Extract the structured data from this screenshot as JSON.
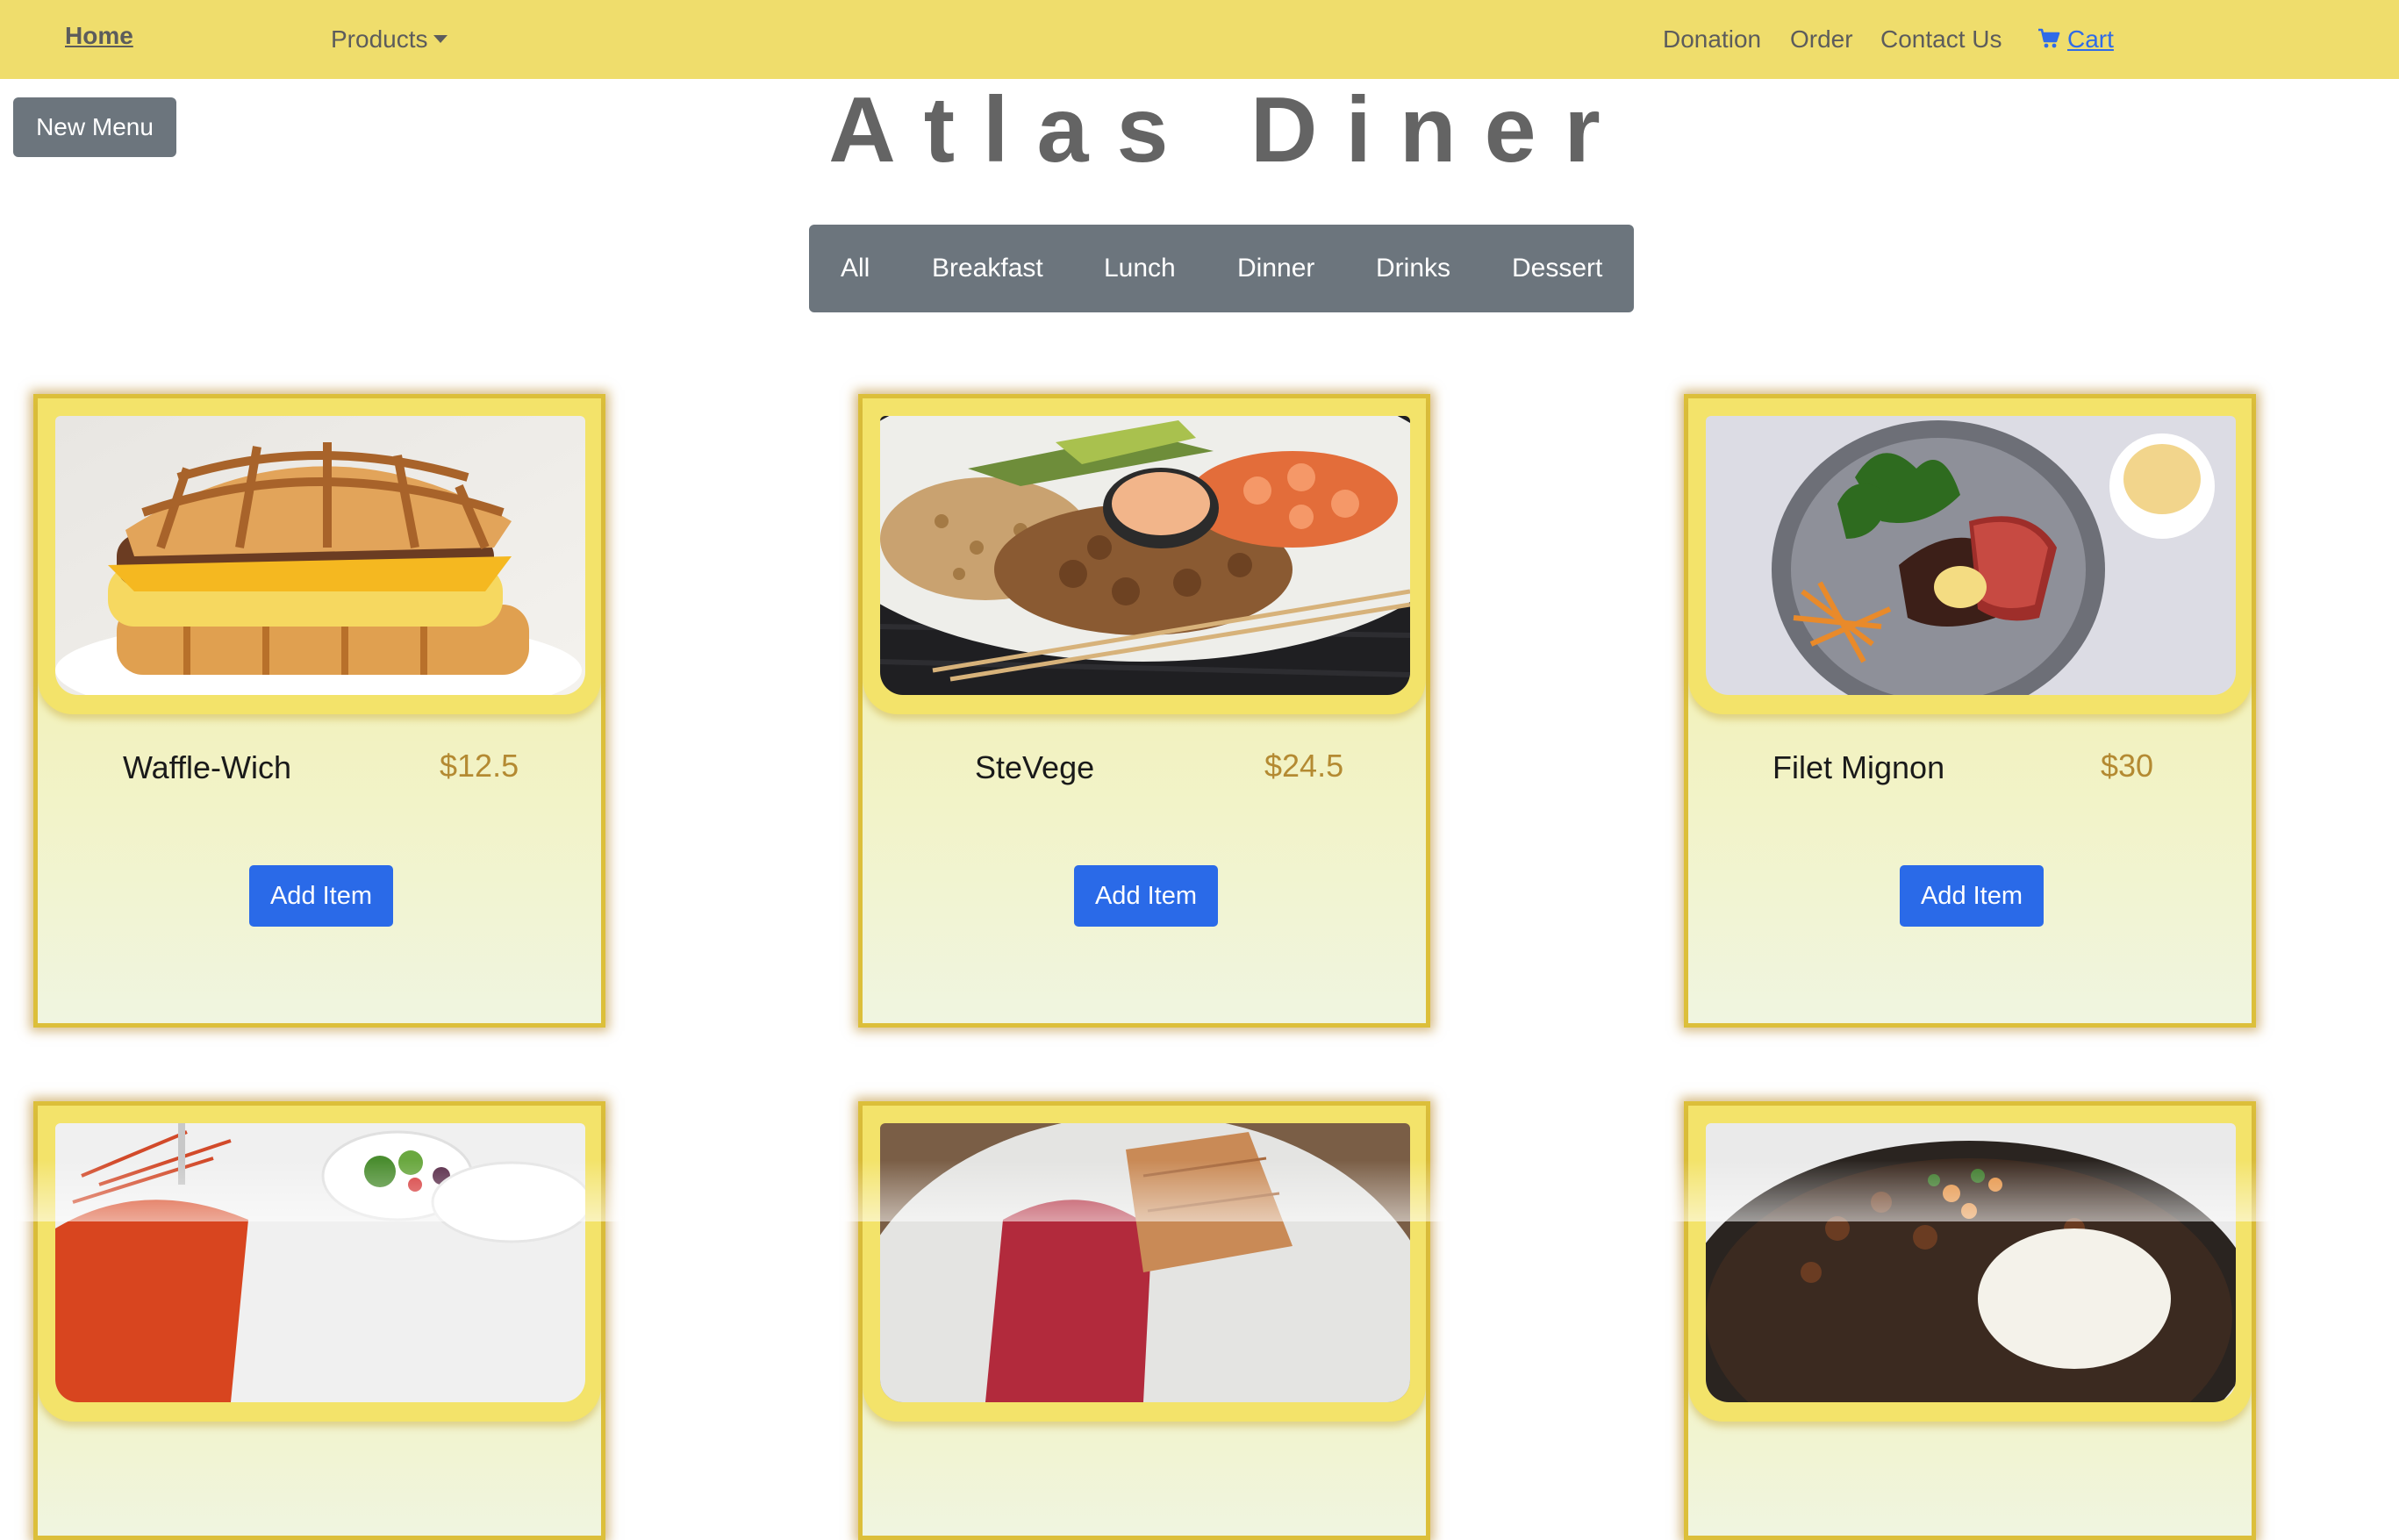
{
  "navbar": {
    "home": "Home",
    "products": "Products",
    "donation": "Donation",
    "order": "Order",
    "contact": "Contact Us",
    "cart": "Cart"
  },
  "new_menu_label": "New Menu",
  "title": "Atlas Diner",
  "filters": [
    "All",
    "Breakfast",
    "Lunch",
    "Dinner",
    "Drinks",
    "Dessert"
  ],
  "menu_items": [
    {
      "name": "Waffle-Wich",
      "price": "$12.5",
      "button": "Add Item",
      "image": "waffle-sandwich"
    },
    {
      "name": "SteVege",
      "price": "$24.5",
      "button": "Add Item",
      "image": "hibachi-plate"
    },
    {
      "name": "Filet Mignon",
      "price": "$30",
      "button": "Add Item",
      "image": "steak-plate"
    },
    {
      "image": "lobster-plate"
    },
    {
      "image": "crepe-plate"
    },
    {
      "image": "rice-bowl"
    }
  ],
  "colors": {
    "navbar": "#efdd6c",
    "accent_button": "#2a6ae8",
    "secondary": "#6c757d",
    "price": "#b48a32",
    "card_border": "#dcbf3a"
  }
}
